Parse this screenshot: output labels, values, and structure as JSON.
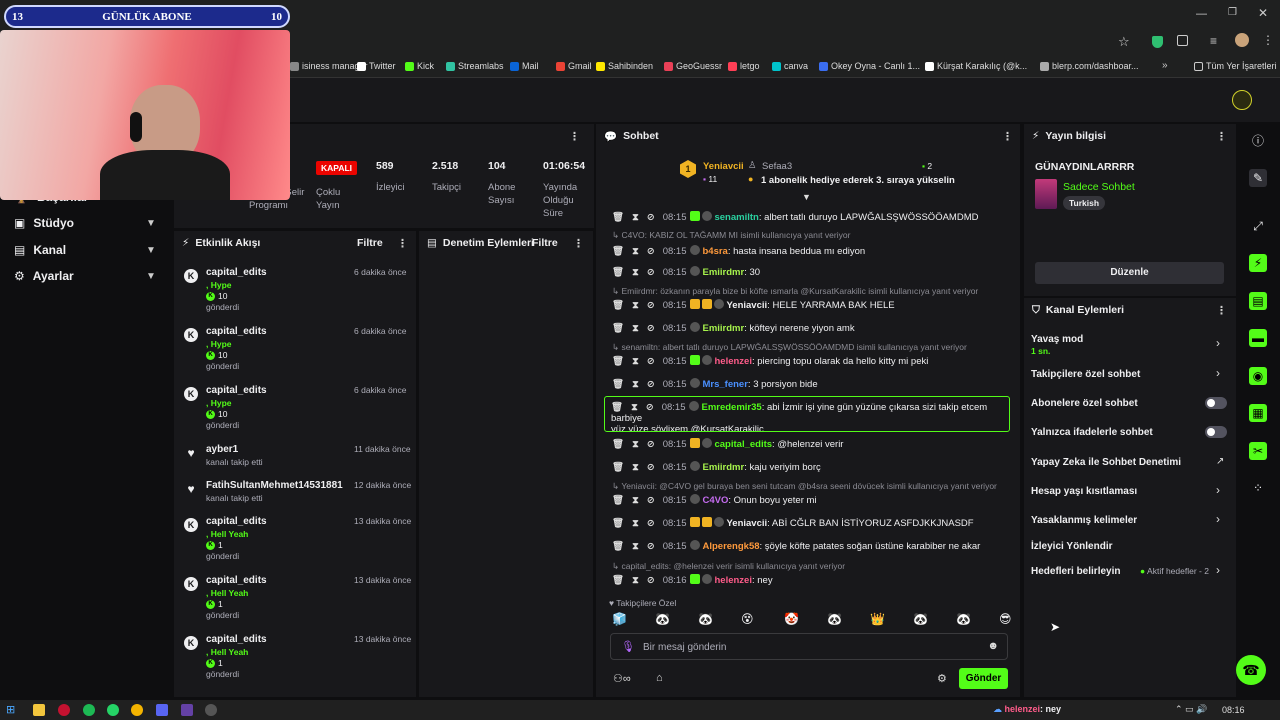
{
  "overlay": {
    "left_num": "13",
    "title": "GÜNLÜK ABONE",
    "right_num": "10"
  },
  "bookmarks": [
    {
      "label": "isiness manager",
      "icon": "business-icon",
      "color": "#888"
    },
    {
      "label": "Twitter",
      "icon": "x-icon",
      "color": "#ffffff"
    },
    {
      "label": "Kick",
      "icon": "kick-icon",
      "color": "#53fc18"
    },
    {
      "label": "Streamlabs",
      "icon": "streamlabs-icon",
      "color": "#31c3a2"
    },
    {
      "label": "Mail",
      "icon": "mail-icon",
      "color": "#0a64d6"
    },
    {
      "label": "Gmail",
      "icon": "gmail-icon",
      "color": "#ea4335"
    },
    {
      "label": "Sahibinden",
      "icon": "sahibinden-icon",
      "color": "#ffe800"
    },
    {
      "label": "GeoGuessr",
      "icon": "pin-icon",
      "color": "#e94057"
    },
    {
      "label": "letgo",
      "icon": "letgo-icon",
      "color": "#ff3f55"
    },
    {
      "label": "canva",
      "icon": "canva-icon",
      "color": "#00c4cc"
    },
    {
      "label": "Okey Oyna - Canlı 1...",
      "icon": "okey-icon",
      "color": "#3a6df0"
    },
    {
      "label": "Kürşat Karakılıç (@k...",
      "icon": "tiktok-icon",
      "color": "#ffffff"
    },
    {
      "label": "blerp.com/dashboar...",
      "icon": "blerp-icon",
      "color": "#aaa"
    }
  ],
  "bookmarks_all": "Tüm Yer İşaretleri",
  "nav": [
    {
      "label": "Başarılar",
      "icon": "trophy-icon"
    },
    {
      "label": "Stüdyo",
      "icon": "studio-icon"
    },
    {
      "label": "Kanal",
      "icon": "channel-icon"
    },
    {
      "label": "Ayarlar",
      "icon": "gear-icon"
    }
  ],
  "stats": {
    "partial_label": "Tahmini Gelir Programı",
    "live_badge": "KAPALI",
    "multi_label": "Çoklu Yayın",
    "viewers": {
      "value": "589",
      "label": "İzleyici"
    },
    "followers": {
      "value": "2.518",
      "label": "Takipçi"
    },
    "subs": {
      "value": "104",
      "label": "Abone Sayısı"
    },
    "uptime": {
      "value": "01:06:54",
      "label": "Yayında Olduğu Süre"
    }
  },
  "activity": {
    "title": "Etkinlik Akışı",
    "filter": "Filtre",
    "events": [
      {
        "name": "capital_edits",
        "time": "6 dakika önce",
        "line2": ", Hype",
        "amount": "10",
        "line4": "gönderdi",
        "icon": "kick-k-icon"
      },
      {
        "name": "capital_edits",
        "time": "6 dakika önce",
        "line2": ", Hype",
        "amount": "10",
        "line4": "gönderdi",
        "icon": "kick-k-icon"
      },
      {
        "name": "capital_edits",
        "time": "6 dakika önce",
        "line2": ", Hype",
        "amount": "10",
        "line4": "gönderdi",
        "icon": "kick-k-icon"
      },
      {
        "name": "ayber1",
        "time": "11 dakika önce",
        "line2": "kanalı takip etti",
        "icon": "heart-icon"
      },
      {
        "name": "FatihSultanMehmet14531881",
        "time": "12 dakika önce",
        "line2": "kanalı takip etti",
        "icon": "heart-icon"
      },
      {
        "name": "capital_edits",
        "time": "13 dakika önce",
        "line2": ", Hell Yeah",
        "amount": "1",
        "line4": "gönderdi",
        "icon": "kick-k-icon"
      },
      {
        "name": "capital_edits",
        "time": "13 dakika önce",
        "line2": ", Hell Yeah",
        "amount": "1",
        "line4": "gönderdi",
        "icon": "kick-k-icon"
      },
      {
        "name": "capital_edits",
        "time": "13 dakika önce",
        "line2": ", Hell Yeah",
        "amount": "1",
        "line4": "gönderdi",
        "icon": "kick-k-icon"
      }
    ]
  },
  "moderation": {
    "title": "Denetim Eylemleri",
    "filter": "Filtre"
  },
  "chat": {
    "title": "Sohbet",
    "pinned": {
      "user1": "Yeniavcii",
      "count1": "11",
      "user2": "Sefaa3",
      "count2": "2",
      "text": "1 abonelik hediye ederek 3. sıraya yükselin"
    },
    "messages": [
      {
        "time": "08:15",
        "user": "senamiltn",
        "color": "#2ad1a0",
        "text": "albert tatlı duruyo LAPWĞALSŞWÖSSÖÖAMDMD"
      },
      {
        "reply": "C4VO: KABIZ OL TAĞAMM MI isimli kullanıcıya yanıt veriyor"
      },
      {
        "time": "08:15",
        "user": "b4sra",
        "color": "#ff9a3c",
        "text": "hasta insana beddua mı ediyon"
      },
      {
        "time": "08:15",
        "user": "Emiirdmr",
        "color": "#a6f24c",
        "text": "30"
      },
      {
        "reply": "Emiirdmr: özkanın parayla bize bi köfte ısmarla @KursatKarakilic isimli kullanıcıya yanıt veriyor"
      },
      {
        "time": "08:15",
        "user": "Yeniavcii",
        "color": "#efeff1",
        "text": "HELE YARRAMA BAK HELE"
      },
      {
        "time": "08:15",
        "user": "Emiirdmr",
        "color": "#a6f24c",
        "text": "köfteyi nerene yiyon amk"
      },
      {
        "reply": "senamiltn: albert tatlı duruyo LAPWĞALSŞWÖSSÖÖAMDMD isimli kullanıcıya yanıt veriyor"
      },
      {
        "time": "08:15",
        "user": "helenzei",
        "color": "#ff5c8a",
        "text": "piercing topu olarak da hello kitty mi peki"
      },
      {
        "time": "08:15",
        "user": "Mrs_fener",
        "color": "#4a90ff",
        "text": "3 porsiyon bide"
      },
      {
        "time": "08:15",
        "user": "Emredemir35",
        "color": "#53fc18",
        "text": "abi İzmir işi yine gün yüzüne çıkarsa sizi takip etcem barbiye",
        "text2": "yüz yüze söylixem @KursatKarakilic",
        "highlight": true
      },
      {
        "time": "08:15",
        "user": "capital_edits",
        "color": "#53fc18",
        "text": "@helenzei verir"
      },
      {
        "time": "08:15",
        "user": "Emiirdmr",
        "color": "#a6f24c",
        "text": "kaju veriyim borç"
      },
      {
        "reply": "Yeniavcii: @C4VO gel buraya ben seni tutcam @b4sra seeni dövücek isimli kullanıcıya yanıt veriyor"
      },
      {
        "time": "08:15",
        "user": "C4VO",
        "color": "#c56cf0",
        "text": "Onun boyu yeter mi"
      },
      {
        "time": "08:15",
        "user": "Yeniavcii",
        "color": "#efeff1",
        "text": "ABİ CĞLR BAN İSTİYORUZ ASFDJKKJNASDF"
      },
      {
        "time": "08:15",
        "user": "Alperengk58",
        "color": "#ff9a3c",
        "text": "şöyle köfte patates soğan üstüne karabiber ne akar"
      },
      {
        "reply": "capital_edits: @helenzei verir isimli kullanıcıya yanıt veriyor"
      },
      {
        "time": "08:16",
        "user": "helenzei",
        "color": "#ff5c8a",
        "text": "ney"
      }
    ],
    "followers_only": "Takipçilere Özel",
    "input_placeholder": "Bir mesaj gönderin",
    "send": "Gönder"
  },
  "stream_info": {
    "title": "Yayın bilgisi",
    "stream_title": "GÜNAYDINLARRRR",
    "category": "Sadece Sohbet",
    "tag": "Turkish",
    "edit": "Düzenle"
  },
  "channel_actions": {
    "title": "Kanal Eylemleri",
    "slow_mode": "Yavaş mod",
    "slow_value": "1 sn.",
    "items": [
      "Takipçilere özel sohbet",
      "Abonelere özel sohbet",
      "Yalnızca ifadelerle sohbet",
      "Yapay Zeka ile Sohbet Denetimi",
      "Hesap yaşı kısıtlaması",
      "Yasaklanmış kelimeler",
      "İzleyici Yönlendir",
      "Hedefleri belirleyin"
    ],
    "goals_status": "Aktif hedefler - 2"
  },
  "taskbar": {
    "chat_user": "helenzei",
    "chat_text": "ney",
    "clock": "08:16"
  },
  "colors": {
    "accent": "#53fc18",
    "bg": "#0e0e10",
    "panel": "#18181b",
    "live_red": "#eb0400"
  }
}
